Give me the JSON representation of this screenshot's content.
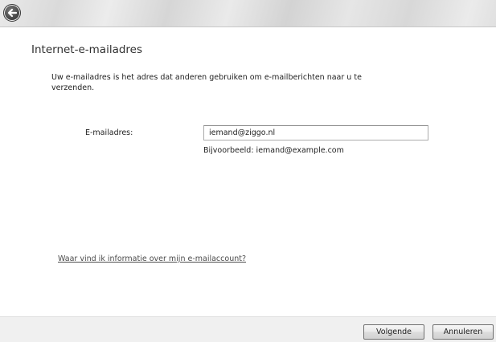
{
  "titlebar": {
    "back_icon": "back-arrow-icon"
  },
  "page": {
    "heading": "Internet-e-mailadres",
    "description": "Uw e-mailadres is het adres dat anderen gebruiken om e-mailberichten naar u te verzenden."
  },
  "form": {
    "email_label": "E-mailadres:",
    "email_value": "iemand@ziggo.nl",
    "example_text": "Bijvoorbeeld: iemand@example.com"
  },
  "help_link": "Waar vind ik informatie over mijn e-mailaccount?",
  "buttons": {
    "next": "Volgende",
    "cancel": "Annuleren"
  }
}
